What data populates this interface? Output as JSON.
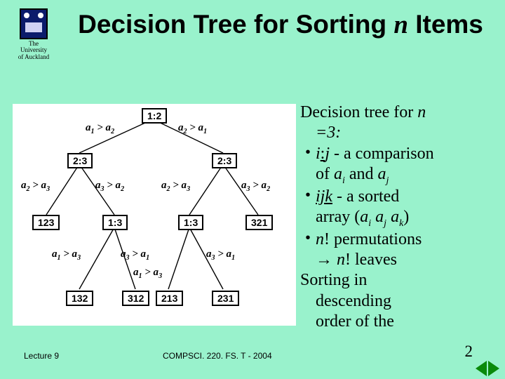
{
  "university": {
    "line1": "The",
    "line2": "University",
    "line3": "of Auckland"
  },
  "title": {
    "pre": "Decision Tree for Sorting ",
    "n": "n",
    "post": " Items"
  },
  "footer": {
    "lecture": "Lecture 9",
    "course": "COMPSCI. 220. FS. T - 2004",
    "page": "2"
  },
  "tree": {
    "root": "1:2",
    "l2a": "2:3",
    "l2b": "2:3",
    "l3_123": "123",
    "l3_13a": "1:3",
    "l3_13b": "1:3",
    "l3_321": "321",
    "l4_132": "132",
    "l4_312": "312",
    "l4_213": "213",
    "l4_231": "231"
  },
  "edges": {
    "e1": "a<sub>1</sub> > a<sub>2</sub>",
    "e2": "a<sub>2</sub> > a<sub>1</sub>",
    "e3": "a<sub>2</sub> > a<sub>3</sub>",
    "e4": "a<sub>3</sub> > a<sub>2</sub>",
    "e5": "a<sub>2</sub> > a<sub>3</sub>",
    "e6": "a<sub>3</sub> > a<sub>2</sub>",
    "e7": "a<sub>1</sub> > a<sub>3</sub>",
    "e8": "a<sub>3</sub> > a<sub>1</sub>",
    "e9": "a<sub>1</sub> > a<sub>3</sub>",
    "e10": "a<sub>3</sub> > a<sub>1</sub>"
  },
  "rhs": {
    "line1a": "Decision tree for ",
    "line1b": "n",
    "line2": " =3:",
    "b1a": "i",
    "b1u": ":",
    "b1b": "j",
    "b1c": " - a comparison",
    "b1d": "of ",
    "b1e": "a",
    "b1f": " and ",
    "b1g": "a",
    "b2a": "ijk",
    "b2b": " - a sorted",
    "b2c": "array (",
    "b2d": "a",
    "b2e": " a",
    "b2f": " a",
    "b2g": ")",
    "b3a": "n",
    "b3b": "! permutations",
    "b3c": "→ ",
    "b3d": "n",
    "b3e": "! leaves",
    "s1": "Sorting in",
    "s2": "descending",
    "s3": "order of the"
  }
}
